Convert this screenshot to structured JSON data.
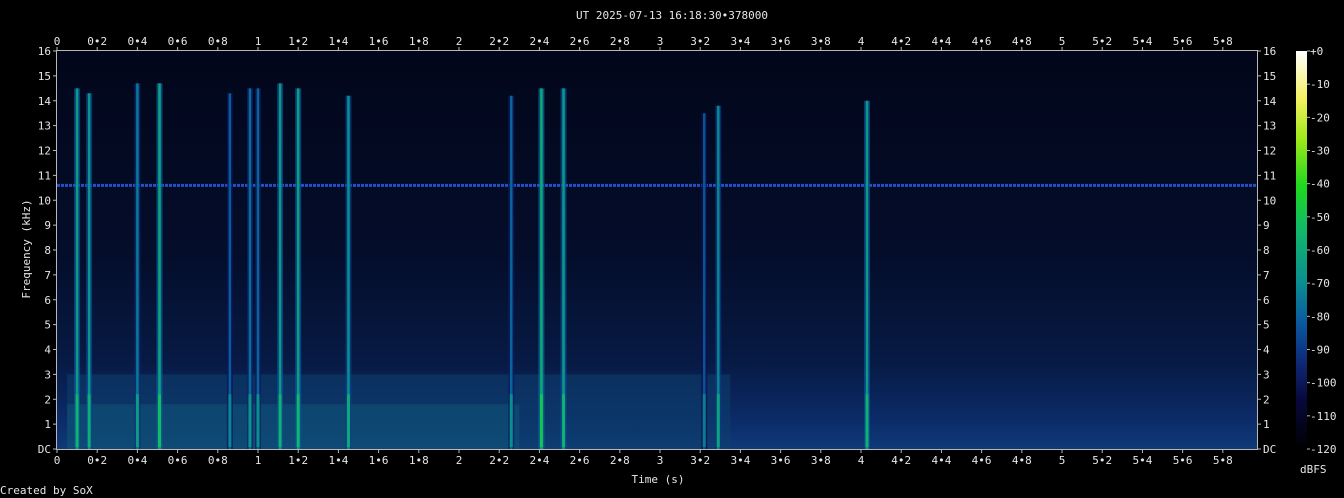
{
  "title": "UT 2025-07-13 16:18:30•378000",
  "footer": "Created by SoX",
  "chart_data": {
    "type": "heatmap",
    "title": "UT 2025-07-13 16:18:30•378000",
    "xlabel": "Time (s)",
    "ylabel": "Frequency (kHz)",
    "xlim": [
      0,
      5.97
    ],
    "ylim": [
      0,
      16
    ],
    "x_ticks": [
      "0",
      "0•2",
      "0•4",
      "0•6",
      "0•8",
      "1",
      "1•2",
      "1•4",
      "1•6",
      "1•8",
      "2",
      "2•2",
      "2•4",
      "2•6",
      "2•8",
      "3",
      "3•2",
      "3•4",
      "3•6",
      "3•8",
      "4",
      "4•2",
      "4•4",
      "4•6",
      "4•8",
      "5",
      "5•2",
      "5•4",
      "5•6",
      "5•8"
    ],
    "x_tick_values": [
      0,
      0.2,
      0.4,
      0.6,
      0.8,
      1.0,
      1.2,
      1.4,
      1.6,
      1.8,
      2.0,
      2.2,
      2.4,
      2.6,
      2.8,
      3.0,
      3.2,
      3.4,
      3.6,
      3.8,
      4.0,
      4.2,
      4.4,
      4.6,
      4.8,
      5.0,
      5.2,
      5.4,
      5.6,
      5.8
    ],
    "y_ticks": [
      "DC",
      "1",
      "2",
      "3",
      "4",
      "5",
      "6",
      "7",
      "8",
      "9",
      "10",
      "11",
      "12",
      "13",
      "14",
      "15",
      "16"
    ],
    "y_tick_values": [
      0,
      1,
      2,
      3,
      4,
      5,
      6,
      7,
      8,
      9,
      10,
      11,
      12,
      13,
      14,
      15,
      16
    ],
    "colorbar": {
      "label": "dBFS",
      "ticks": [
        "+0",
        "-10",
        "-20",
        "-30",
        "-40",
        "-50",
        "-60",
        "-70",
        "-80",
        "-90",
        "-100",
        "-110",
        "-120"
      ],
      "tick_values": [
        0,
        -10,
        -20,
        -30,
        -40,
        -50,
        -60,
        -70,
        -80,
        -90,
        -100,
        -110,
        -120
      ],
      "range": [
        -120,
        0
      ]
    },
    "tone_line_khz": 10.6,
    "broadband_events": [
      {
        "t": 0.1,
        "fmax": 14.5,
        "level": -65
      },
      {
        "t": 0.16,
        "fmax": 14.3,
        "level": -68
      },
      {
        "t": 0.4,
        "fmax": 14.7,
        "level": -75
      },
      {
        "t": 0.51,
        "fmax": 14.7,
        "level": -62
      },
      {
        "t": 0.86,
        "fmax": 14.3,
        "level": -82
      },
      {
        "t": 0.96,
        "fmax": 14.5,
        "level": -78
      },
      {
        "t": 1.0,
        "fmax": 14.5,
        "level": -80
      },
      {
        "t": 1.11,
        "fmax": 14.7,
        "level": -66
      },
      {
        "t": 1.2,
        "fmax": 14.5,
        "level": -64
      },
      {
        "t": 1.45,
        "fmax": 14.2,
        "level": -70
      },
      {
        "t": 2.26,
        "fmax": 14.2,
        "level": -80
      },
      {
        "t": 2.41,
        "fmax": 14.5,
        "level": -60
      },
      {
        "t": 2.52,
        "fmax": 14.5,
        "level": -66
      },
      {
        "t": 3.22,
        "fmax": 13.5,
        "level": -84
      },
      {
        "t": 3.29,
        "fmax": 13.8,
        "level": -72
      },
      {
        "t": 4.03,
        "fmax": 14.0,
        "level": -66
      }
    ],
    "noise_floor_db": -112
  }
}
